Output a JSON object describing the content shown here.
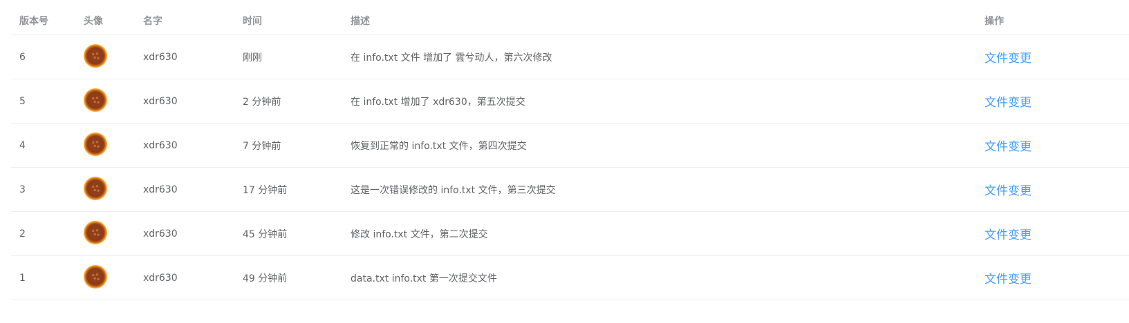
{
  "columns": {
    "version": "版本号",
    "avatar": "头像",
    "name": "名字",
    "time": "时间",
    "description": "描述",
    "action": "操作"
  },
  "rows": [
    {
      "version": "6",
      "name": "xdr630",
      "time": "刚刚",
      "description": "在 info.txt 文件 增加了 雲兮动人，第六次修改",
      "action": "文件变更"
    },
    {
      "version": "5",
      "name": "xdr630",
      "time": "2 分钟前",
      "description": "在 info.txt 增加了 xdr630，第五次提交",
      "action": "文件变更"
    },
    {
      "version": "4",
      "name": "xdr630",
      "time": "7 分钟前",
      "description": "恢复到正常的 info.txt 文件，第四次提交",
      "action": "文件变更"
    },
    {
      "version": "3",
      "name": "xdr630",
      "time": "17 分钟前",
      "description": "这是一次错误修改的 info.txt 文件，第三次提交",
      "action": "文件变更"
    },
    {
      "version": "2",
      "name": "xdr630",
      "time": "45 分钟前",
      "description": "修改 info.txt 文件，第二次提交",
      "action": "文件变更"
    },
    {
      "version": "1",
      "name": "xdr630",
      "time": "49 分钟前",
      "description": "data.txt info.txt 第一次提交文件",
      "action": "文件变更"
    }
  ],
  "colors": {
    "link": "#409eff",
    "header_text": "#909399",
    "body_text": "#606266",
    "divider": "#ebeef5"
  },
  "icons": {
    "avatar": "cookie-avatar-icon"
  }
}
